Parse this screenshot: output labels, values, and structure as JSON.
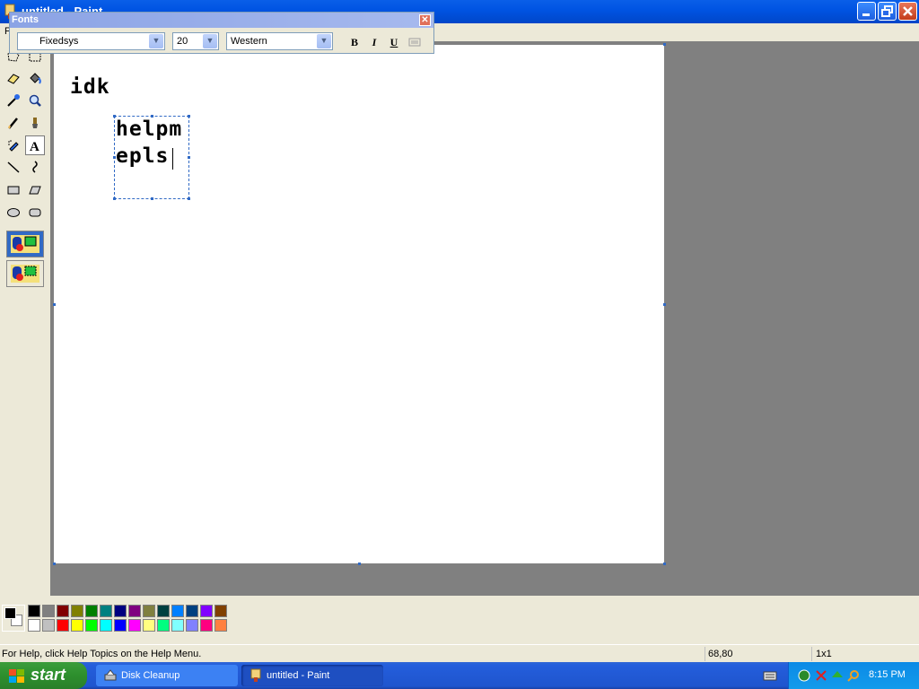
{
  "window": {
    "title": "untitled - Paint"
  },
  "menu": {
    "first_item": "F"
  },
  "fonts_toolbar": {
    "title": "Fonts",
    "font_name": "Fixedsys",
    "font_size": "20",
    "script": "Western",
    "bold_label": "B",
    "italic_label": "I",
    "underline_label": "U"
  },
  "canvas": {
    "text_idk": "idk",
    "textbox_line1": "helpm",
    "textbox_line2": "epls"
  },
  "tools": [
    "free-form-select",
    "select",
    "eraser",
    "fill-with-color",
    "pick-color",
    "magnifier",
    "pencil",
    "brush",
    "airbrush",
    "text",
    "line",
    "curve",
    "rectangle",
    "polygon",
    "ellipse",
    "rounded-rectangle"
  ],
  "palette": {
    "foreground": "#000000",
    "background": "#ffffff",
    "row1": [
      "#000000",
      "#808080",
      "#800000",
      "#808000",
      "#008000",
      "#008080",
      "#000080",
      "#800080",
      "#808040",
      "#004040",
      "#0080ff",
      "#004080",
      "#8000ff",
      "#804000"
    ],
    "row2": [
      "#ffffff",
      "#c0c0c0",
      "#ff0000",
      "#ffff00",
      "#00ff00",
      "#00ffff",
      "#0000ff",
      "#ff00ff",
      "#ffff80",
      "#00ff80",
      "#80ffff",
      "#8080ff",
      "#ff0080",
      "#ff8040"
    ]
  },
  "statusbar": {
    "help": "For Help, click Help Topics on the Help Menu.",
    "coords": "68,80",
    "size": "1x1"
  },
  "taskbar": {
    "start_label": "start",
    "tasks": [
      {
        "label": "Disk Cleanup"
      },
      {
        "label": "untitled - Paint"
      }
    ],
    "clock": "8:15 PM"
  }
}
